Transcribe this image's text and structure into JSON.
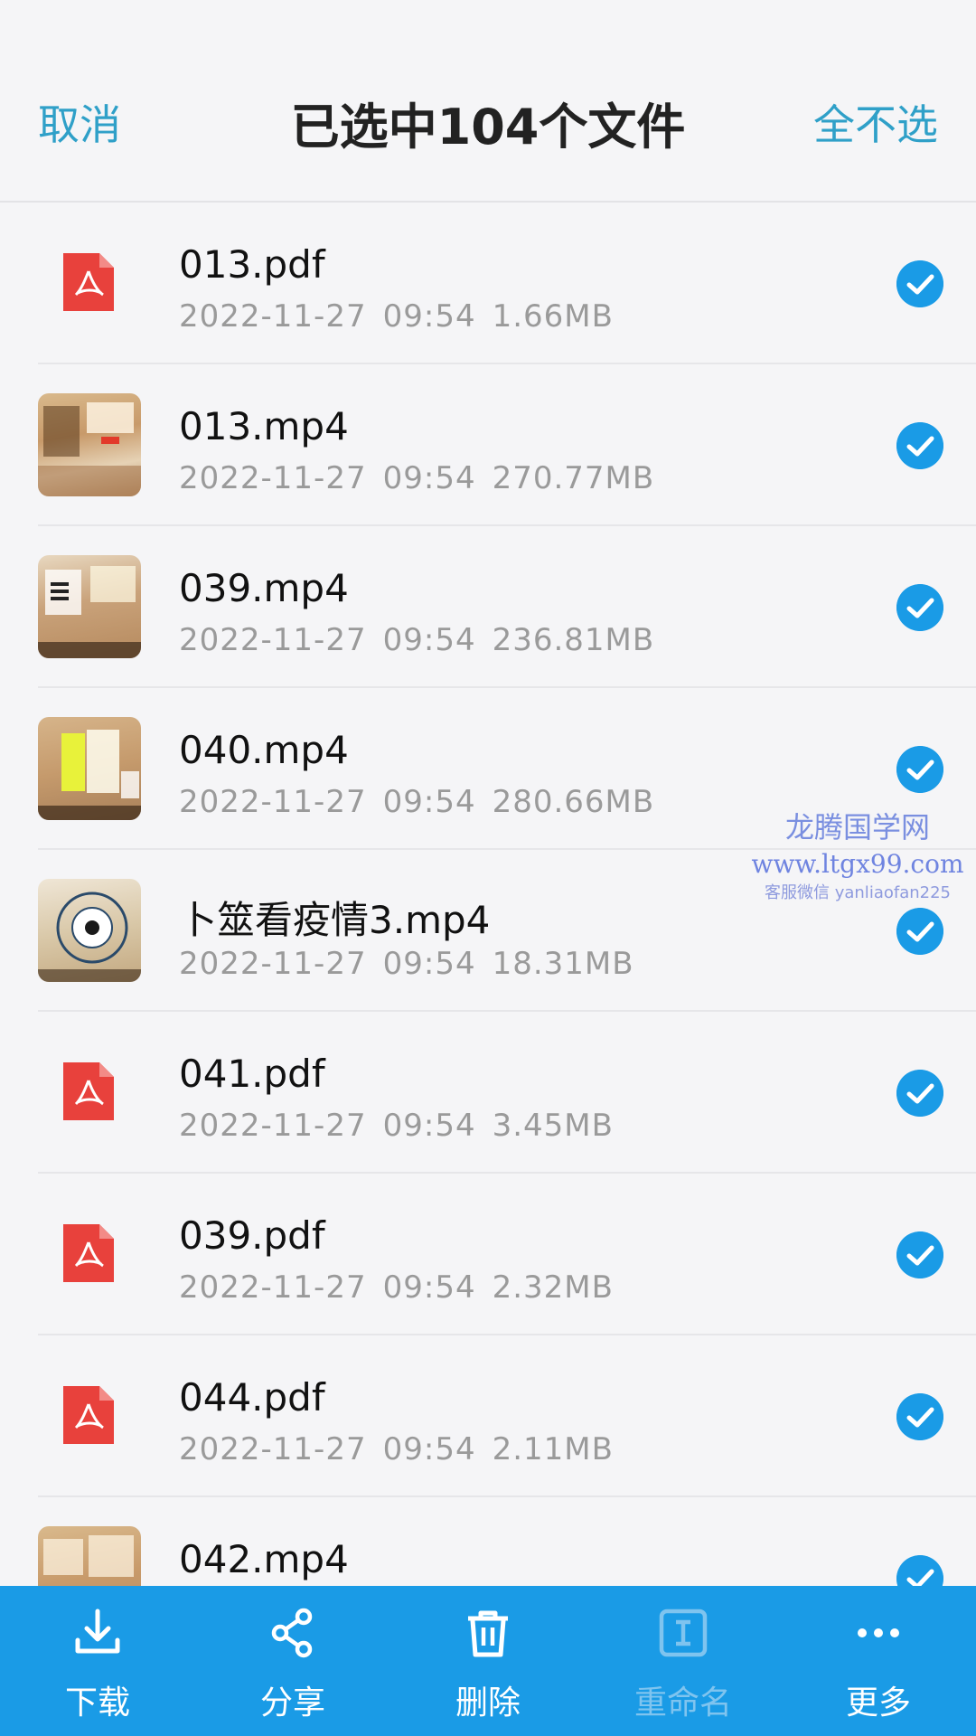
{
  "header": {
    "cancel_label": "取消",
    "title": "已选中104个文件",
    "deselect_all_label": "全不选"
  },
  "files": [
    {
      "name": "013.pdf",
      "date": "2022-11-27",
      "time": "09:54",
      "size": "1.66MB",
      "type": "pdf",
      "icon": "pdf-icon",
      "checked": true
    },
    {
      "name": "013.mp4",
      "date": "2022-11-27",
      "time": "09:54",
      "size": "270.77MB",
      "type": "video",
      "icon": "video-thumbnail",
      "checked": true
    },
    {
      "name": "039.mp4",
      "date": "2022-11-27",
      "time": "09:54",
      "size": "236.81MB",
      "type": "video",
      "icon": "video-thumbnail",
      "checked": true
    },
    {
      "name": "040.mp4",
      "date": "2022-11-27",
      "time": "09:54",
      "size": "280.66MB",
      "type": "video",
      "icon": "video-thumbnail",
      "checked": true
    },
    {
      "name": "卜筮看疫情3.mp4",
      "date": "2022-11-27",
      "time": "09:54",
      "size": "18.31MB",
      "type": "video",
      "icon": "video-thumbnail",
      "checked": true
    },
    {
      "name": "041.pdf",
      "date": "2022-11-27",
      "time": "09:54",
      "size": "3.45MB",
      "type": "pdf",
      "icon": "pdf-icon",
      "checked": true
    },
    {
      "name": "039.pdf",
      "date": "2022-11-27",
      "time": "09:54",
      "size": "2.32MB",
      "type": "pdf",
      "icon": "pdf-icon",
      "checked": true
    },
    {
      "name": "044.pdf",
      "date": "2022-11-27",
      "time": "09:54",
      "size": "2.11MB",
      "type": "pdf",
      "icon": "pdf-icon",
      "checked": true
    },
    {
      "name": "042.mp4",
      "date": "",
      "time": "",
      "size": "",
      "type": "video",
      "icon": "video-thumbnail",
      "checked": true
    }
  ],
  "watermark": {
    "line1": "龙腾国学网",
    "line2": "www.ltgx99.com",
    "line3": "客服微信 yanliaofan225"
  },
  "toolbar": {
    "items": [
      {
        "label": "下载",
        "icon": "download-icon",
        "enabled": true
      },
      {
        "label": "分享",
        "icon": "share-icon",
        "enabled": true
      },
      {
        "label": "删除",
        "icon": "trash-icon",
        "enabled": true
      },
      {
        "label": "重命名",
        "icon": "rename-icon",
        "enabled": false
      },
      {
        "label": "更多",
        "icon": "more-icon",
        "enabled": true
      }
    ]
  },
  "colors": {
    "accent": "#1a9be6",
    "link": "#2fa0c8",
    "pdf_red": "#e8413c",
    "meta_gray": "#9a9a9a",
    "background": "#f5f5f7"
  }
}
